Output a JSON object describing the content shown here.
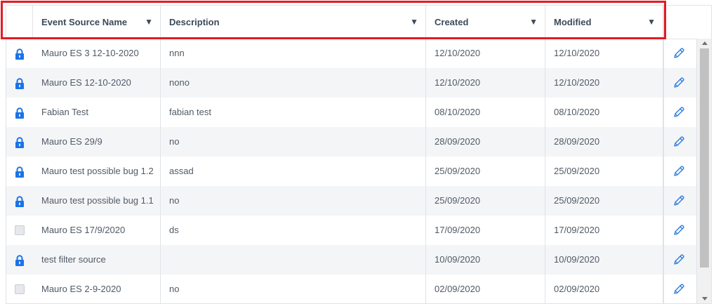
{
  "columns": {
    "name": "Event Source Name",
    "description": "Description",
    "created": "Created",
    "modified": "Modified",
    "sort_glyph": "▼"
  },
  "colors": {
    "highlight": "#e31b23",
    "lock": "#1a73e8",
    "pencil": "#2d7be0",
    "header_text": "#3b4a5a"
  },
  "rows": [
    {
      "icon": "lock-icon",
      "name": "Mauro ES 3 12-10-2020",
      "description": "nnn",
      "created": "12/10/2020",
      "modified": "12/10/2020"
    },
    {
      "icon": "lock-icon",
      "name": "Mauro ES 12-10-2020",
      "description": "nono",
      "created": "12/10/2020",
      "modified": "12/10/2020"
    },
    {
      "icon": "lock-icon",
      "name": "Fabian Test",
      "description": "fabian test",
      "created": "08/10/2020",
      "modified": "08/10/2020"
    },
    {
      "icon": "lock-icon",
      "name": "Mauro ES 29/9",
      "description": "no",
      "created": "28/09/2020",
      "modified": "28/09/2020"
    },
    {
      "icon": "lock-icon",
      "name": "Mauro test possible bug 1.2",
      "description": "assad",
      "created": "25/09/2020",
      "modified": "25/09/2020"
    },
    {
      "icon": "lock-icon",
      "name": "Mauro test possible bug 1.1",
      "description": "no",
      "created": "25/09/2020",
      "modified": "25/09/2020"
    },
    {
      "icon": "checkbox-icon",
      "name": "Mauro ES 17/9/2020",
      "description": "ds",
      "created": "17/09/2020",
      "modified": "17/09/2020"
    },
    {
      "icon": "lock-icon",
      "name": "test filter source",
      "description": "",
      "created": "10/09/2020",
      "modified": "10/09/2020"
    },
    {
      "icon": "checkbox-icon",
      "name": "Mauro ES 2-9-2020",
      "description": "no",
      "created": "02/09/2020",
      "modified": "02/09/2020"
    }
  ]
}
